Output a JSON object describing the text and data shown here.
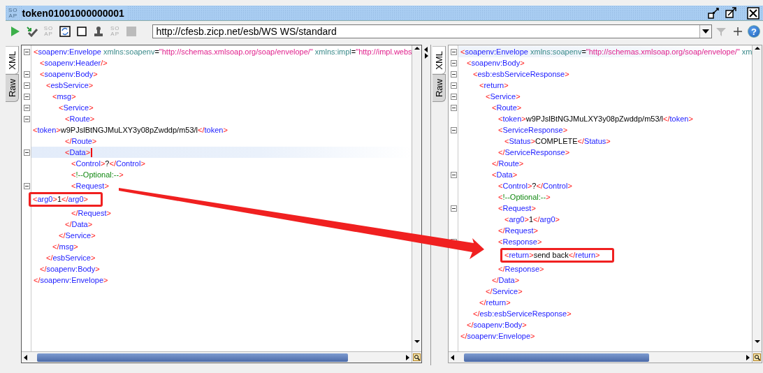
{
  "window": {
    "icon_lines": [
      "SO",
      "AP"
    ],
    "title": "token01001000000001"
  },
  "toolbar": {
    "buttons": [
      {
        "kind": "run",
        "disabled": false
      },
      {
        "kind": "check",
        "disabled": false
      },
      {
        "kind": "soap",
        "lines": [
          "SO",
          "AP"
        ],
        "disabled": true
      },
      {
        "kind": "refresh",
        "disabled": false
      },
      {
        "kind": "square",
        "disabled": false
      },
      {
        "kind": "stamp",
        "disabled": false
      },
      {
        "kind": "soap",
        "lines": [
          "SO",
          "AP"
        ],
        "disabled": true
      },
      {
        "kind": "stop",
        "disabled": true
      }
    ],
    "url": "http://cfesb.zicp.net/esb/WS WS/standard",
    "right_buttons": [
      {
        "kind": "filter",
        "disabled": true
      },
      {
        "kind": "add",
        "disabled": false
      },
      {
        "kind": "help",
        "label": "?",
        "disabled": false
      }
    ]
  },
  "request_pane": {
    "focused": true,
    "tabs": [
      {
        "label": "XML",
        "selected": true
      },
      {
        "label": "Raw",
        "selected": false
      }
    ],
    "lines": [
      {
        "xml": "<soapenv:Envelope xmlns:soapenv=\"http://schemas.xmlsoap.org/soap/envelope/\" xmlns:impl=\"http://impl.webs",
        "fold": true,
        "current": false,
        "flush": false,
        "boxed": false,
        "children": [
          {
            "xml": "<soapenv:Header/>",
            "fold": false,
            "current": false,
            "flush": false,
            "boxed": false
          },
          {
            "xml": "<soapenv:Body>",
            "fold": true,
            "current": false,
            "flush": false,
            "boxed": false,
            "children": [
              {
                "xml": "<esbService>",
                "fold": true,
                "current": false,
                "flush": false,
                "boxed": false,
                "children": [
                  {
                    "xml": "<msg>",
                    "fold": true,
                    "current": false,
                    "flush": false,
                    "boxed": false,
                    "children": [
                      {
                        "xml": "<Service>",
                        "fold": true,
                        "current": false,
                        "flush": false,
                        "boxed": false,
                        "children": [
                          {
                            "xml": "<Route>",
                            "fold": true,
                            "current": false,
                            "flush": false,
                            "boxed": false,
                            "children": [
                              {
                                "xml": "<token>w9PJslBtNGJMuLXY3y08pZwddp/m53/l</token>",
                                "fold": false,
                                "current": false,
                                "flush": true,
                                "boxed": false
                              }
                            ]
                          },
                          {
                            "xml": "</Route>",
                            "fold": false,
                            "current": false,
                            "flush": false,
                            "boxed": false
                          },
                          {
                            "xml": "<Data>",
                            "fold": true,
                            "current": true,
                            "flush": false,
                            "boxed": false,
                            "children": [
                              {
                                "xml": "<Control>?</Control>",
                                "fold": false,
                                "current": false,
                                "flush": false,
                                "boxed": false
                              },
                              {
                                "xml": "<!--Optional:-->",
                                "fold": false,
                                "current": false,
                                "flush": false,
                                "boxed": false
                              },
                              {
                                "xml": "<Request>",
                                "fold": true,
                                "current": false,
                                "flush": false,
                                "boxed": false,
                                "children": [
                                  {
                                    "xml": "<arg0>1</arg0>",
                                    "fold": false,
                                    "current": false,
                                    "flush": true,
                                    "boxed": true
                                  }
                                ]
                              },
                              {
                                "xml": "</Request>",
                                "fold": false,
                                "current": false,
                                "flush": false,
                                "boxed": false
                              }
                            ]
                          },
                          {
                            "xml": "</Data>",
                            "fold": false,
                            "current": false,
                            "flush": false,
                            "boxed": false
                          }
                        ]
                      },
                      {
                        "xml": "</Service>",
                        "fold": false,
                        "current": false,
                        "flush": false,
                        "boxed": false
                      }
                    ]
                  },
                  {
                    "xml": "</msg>",
                    "fold": false,
                    "current": false,
                    "flush": false,
                    "boxed": false
                  }
                ]
              },
              {
                "xml": "</esbService>",
                "fold": false,
                "current": false,
                "flush": false,
                "boxed": false
              }
            ]
          },
          {
            "xml": "</soapenv:Body>",
            "fold": false,
            "current": false,
            "flush": false,
            "boxed": false
          }
        ]
      },
      {
        "xml": "</soapenv:Envelope>",
        "fold": false,
        "current": false,
        "flush": false,
        "boxed": false
      }
    ]
  },
  "response_pane": {
    "focused": false,
    "tabs": [
      {
        "label": "XML",
        "selected": true
      },
      {
        "label": "Raw",
        "selected": false
      }
    ],
    "lines": [
      {
        "xml": "<soapenv:Envelope xmlns:soapenv=\"http://schemas.xmlsoap.org/soap/envelope/\" xm",
        "fold": true,
        "current": true,
        "flush": false,
        "boxed": false,
        "children": [
          {
            "xml": "<soapenv:Body>",
            "fold": true,
            "current": false,
            "flush": false,
            "boxed": false,
            "children": [
              {
                "xml": "<esb:esbServiceResponse>",
                "fold": true,
                "current": false,
                "flush": false,
                "boxed": false,
                "children": [
                  {
                    "xml": "<return>",
                    "fold": true,
                    "current": false,
                    "flush": false,
                    "boxed": false,
                    "children": [
                      {
                        "xml": "<Service>",
                        "fold": true,
                        "current": false,
                        "flush": false,
                        "boxed": false,
                        "children": [
                          {
                            "xml": "<Route>",
                            "fold": true,
                            "current": false,
                            "flush": false,
                            "boxed": false,
                            "children": [
                              {
                                "xml": "<token>w9PJslBtNGJMuLXY3y08pZwddp/m53/l</token>",
                                "fold": false,
                                "current": false,
                                "flush": false,
                                "boxed": false
                              },
                              {
                                "xml": "<ServiceResponse>",
                                "fold": true,
                                "current": false,
                                "flush": false,
                                "boxed": false,
                                "children": [
                                  {
                                    "xml": "<Status>COMPLETE</Status>",
                                    "fold": false,
                                    "current": false,
                                    "flush": false,
                                    "boxed": false
                                  }
                                ]
                              },
                              {
                                "xml": "</ServiceResponse>",
                                "fold": false,
                                "current": false,
                                "flush": false,
                                "boxed": false
                              }
                            ]
                          },
                          {
                            "xml": "</Route>",
                            "fold": false,
                            "current": false,
                            "flush": false,
                            "boxed": false
                          },
                          {
                            "xml": "<Data>",
                            "fold": true,
                            "current": false,
                            "flush": false,
                            "boxed": false,
                            "children": [
                              {
                                "xml": "<Control>?</Control>",
                                "fold": false,
                                "current": false,
                                "flush": false,
                                "boxed": false
                              },
                              {
                                "xml": "<!--Optional:-->",
                                "fold": false,
                                "current": false,
                                "flush": false,
                                "boxed": false
                              },
                              {
                                "xml": "<Request>",
                                "fold": true,
                                "current": false,
                                "flush": false,
                                "boxed": false,
                                "children": [
                                  {
                                    "xml": "<arg0>1</arg0>",
                                    "fold": false,
                                    "current": false,
                                    "flush": false,
                                    "boxed": false
                                  }
                                ]
                              },
                              {
                                "xml": "</Request>",
                                "fold": false,
                                "current": false,
                                "flush": false,
                                "boxed": false
                              },
                              {
                                "xml": "<Response>",
                                "fold": true,
                                "current": false,
                                "flush": false,
                                "boxed": false,
                                "children": [
                                  {
                                    "xml": "<return>send back</return>",
                                    "fold": false,
                                    "current": false,
                                    "flush": false,
                                    "boxed": true
                                  }
                                ]
                              },
                              {
                                "xml": "</Response>",
                                "fold": false,
                                "current": false,
                                "flush": false,
                                "boxed": false
                              }
                            ]
                          },
                          {
                            "xml": "</Data>",
                            "fold": false,
                            "current": false,
                            "flush": false,
                            "boxed": false
                          }
                        ]
                      },
                      {
                        "xml": "</Service>",
                        "fold": false,
                        "current": false,
                        "flush": false,
                        "boxed": false
                      }
                    ]
                  },
                  {
                    "xml": "</return>",
                    "fold": false,
                    "current": false,
                    "flush": false,
                    "boxed": false
                  }
                ]
              },
              {
                "xml": "</esb:esbServiceResponse>",
                "fold": false,
                "current": false,
                "flush": false,
                "boxed": false
              }
            ]
          },
          {
            "xml": "</soapenv:Body>",
            "fold": false,
            "current": false,
            "flush": false,
            "boxed": false
          }
        ]
      },
      {
        "xml": "</soapenv:Envelope>",
        "fold": false,
        "current": false,
        "flush": false,
        "boxed": false
      }
    ]
  }
}
